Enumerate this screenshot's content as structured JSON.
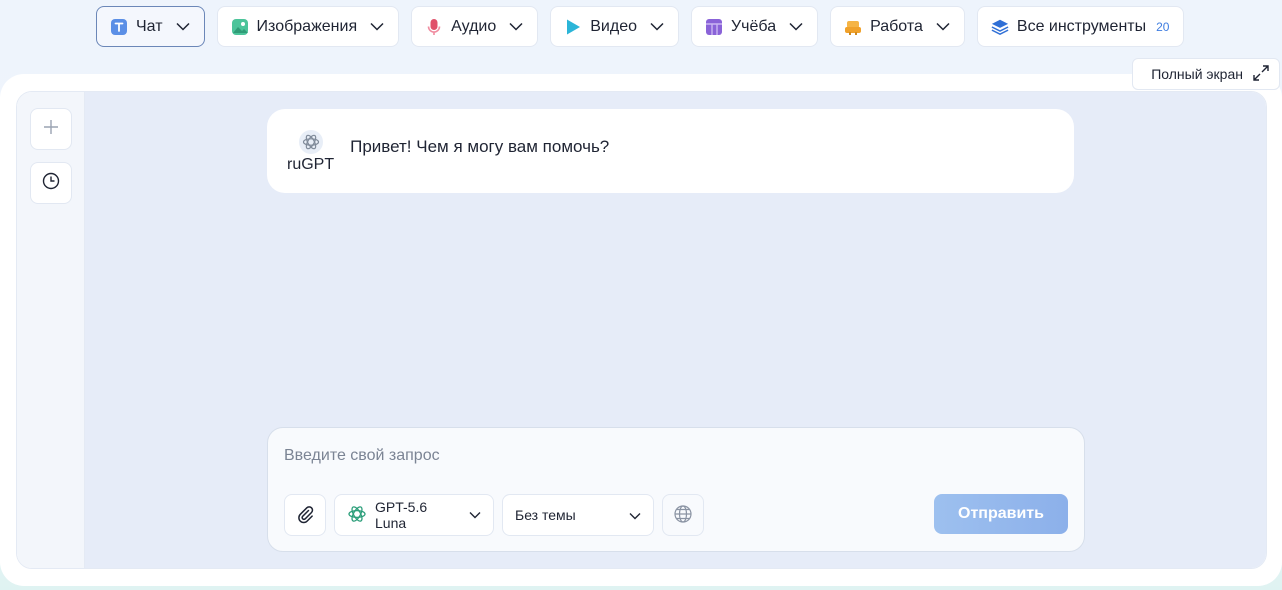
{
  "nav": {
    "items": [
      {
        "label": "Чат",
        "icon": "text-t-icon",
        "active": true
      },
      {
        "label": "Изображения",
        "icon": "image-icon"
      },
      {
        "label": "Аудио",
        "icon": "microphone-icon"
      },
      {
        "label": "Видео",
        "icon": "play-icon"
      },
      {
        "label": "Учёба",
        "icon": "book-icon"
      },
      {
        "label": "Работа",
        "icon": "briefcase-icon"
      },
      {
        "label": "Все инструменты",
        "icon": "layers-icon",
        "count": "20"
      }
    ]
  },
  "fullscreen": {
    "label": "Полный экран"
  },
  "chat": {
    "bot_name": "ruGPT",
    "greeting": "Привет! Чем я могу вам помочь?"
  },
  "composer": {
    "placeholder": "Введите свой запрос",
    "value": "",
    "model": "GPT-5.6 Luna",
    "topic": "Без темы",
    "send_label": "Отправить"
  },
  "colors": {
    "accent": "#3f7de0",
    "send": "#9dc0ef",
    "chat_bg": "#e6ecf8"
  }
}
